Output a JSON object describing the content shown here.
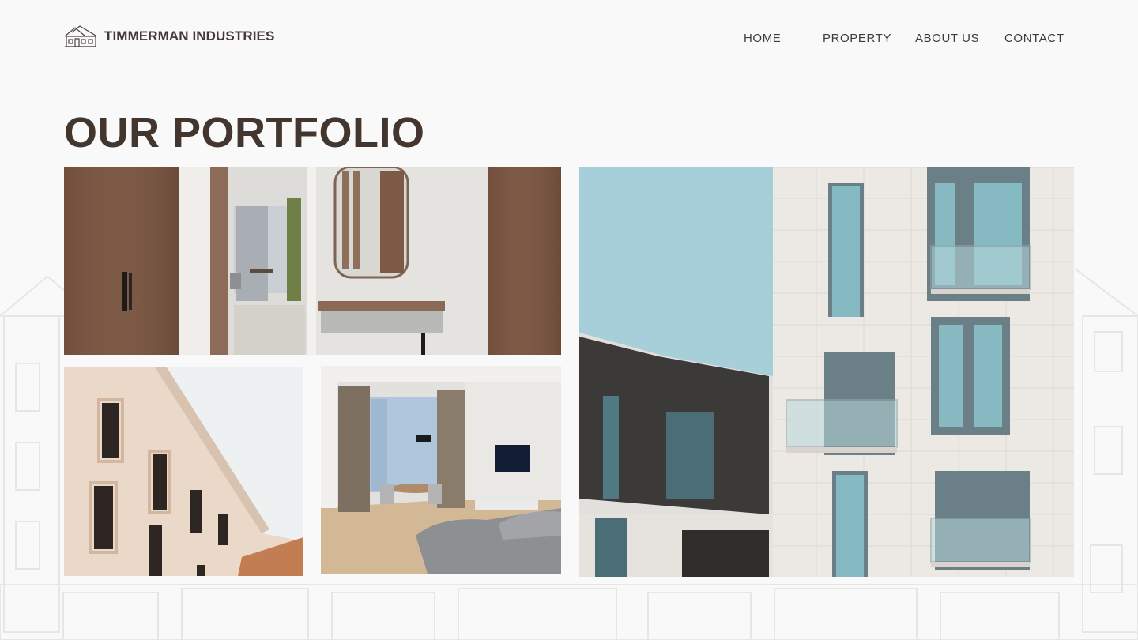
{
  "brand": {
    "name": "TIMMERMAN INDUSTRIES",
    "logo_icon": "house-outline-icon"
  },
  "nav": {
    "items": [
      {
        "label": "HOME"
      },
      {
        "label": "PROPERTY"
      },
      {
        "label": "ABOUT US"
      },
      {
        "label": "CONTACT"
      }
    ]
  },
  "portfolio": {
    "title": "OUR PORTFOLIO",
    "photos": [
      {
        "subject": "hallway-wardrobe-mirror-interior"
      },
      {
        "subject": "cream-facade-classic-windows"
      },
      {
        "subject": "living-room-grey-sofa-interior"
      },
      {
        "subject": "modern-white-apartment-building-balconies"
      }
    ]
  },
  "colors": {
    "background": "#f9f9f9",
    "heading": "#43362f",
    "text": "#3f3a3c"
  }
}
